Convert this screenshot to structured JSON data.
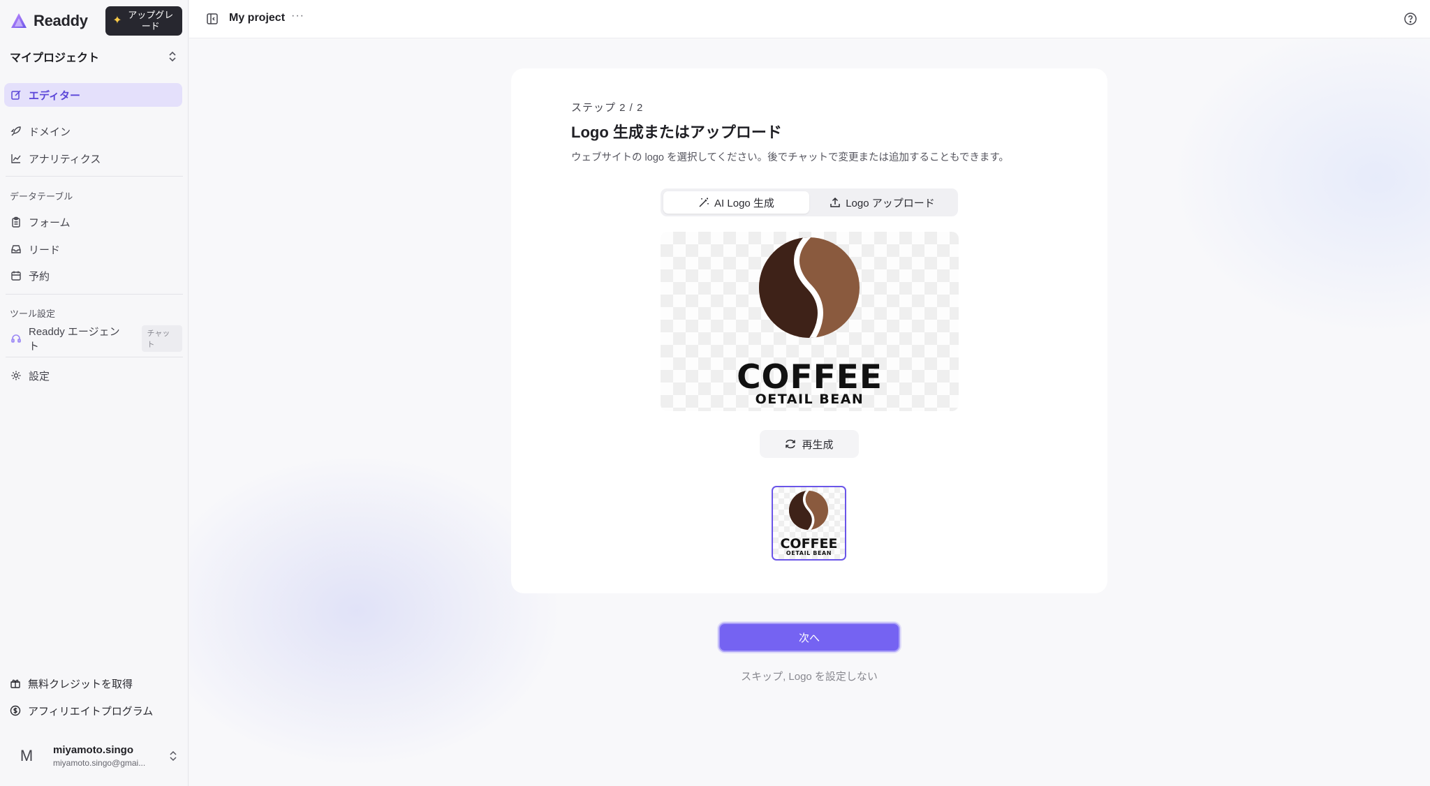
{
  "app": {
    "brand": "Readdy",
    "upgrade_label": "アップグレード"
  },
  "sidebar": {
    "project_selector": "マイプロジェクト",
    "items": [
      {
        "label": "エディター",
        "icon": "edit-icon",
        "active": true
      },
      {
        "label": "ドメイン",
        "icon": "rocket-icon"
      },
      {
        "label": "アナリティクス",
        "icon": "chart-icon"
      }
    ],
    "data_section": {
      "label": "データテーブル",
      "items": [
        {
          "label": "フォーム",
          "icon": "clipboard-icon"
        },
        {
          "label": "リード",
          "icon": "inbox-icon"
        },
        {
          "label": "予約",
          "icon": "calendar-icon"
        }
      ]
    },
    "tools_section": {
      "label": "ツール設定",
      "agent_label": "Readdy エージェント",
      "agent_badge": "チャット"
    },
    "settings_label": "設定",
    "bottom": {
      "free_credit": "無料クレジットを取得",
      "affiliate": "アフィリエイトプログラム"
    },
    "user": {
      "initial": "M",
      "name": "miyamoto.singo",
      "email": "miyamoto.singo@gmai..."
    }
  },
  "header": {
    "project_title": "My project",
    "more": "···"
  },
  "wizard": {
    "step": "ステップ 2 / 2",
    "title": "Logo 生成またはアップロード",
    "description": "ウェブサイトの logo を選択してください。後でチャットで変更または追加することもできます。",
    "tabs": [
      {
        "label": "AI Logo 生成",
        "active": true
      },
      {
        "label": "Logo アップロード",
        "active": false
      }
    ],
    "logo": {
      "word": "COFFEE",
      "tagline": "OETAIL BEAN"
    },
    "regenerate_label": "再生成",
    "next_label": "次へ",
    "skip_label": "スキップ, Logo を設定しない"
  },
  "colors": {
    "accent": "#7563f2",
    "bean_dark": "#3e2218",
    "bean_light": "#8a5a3e"
  }
}
